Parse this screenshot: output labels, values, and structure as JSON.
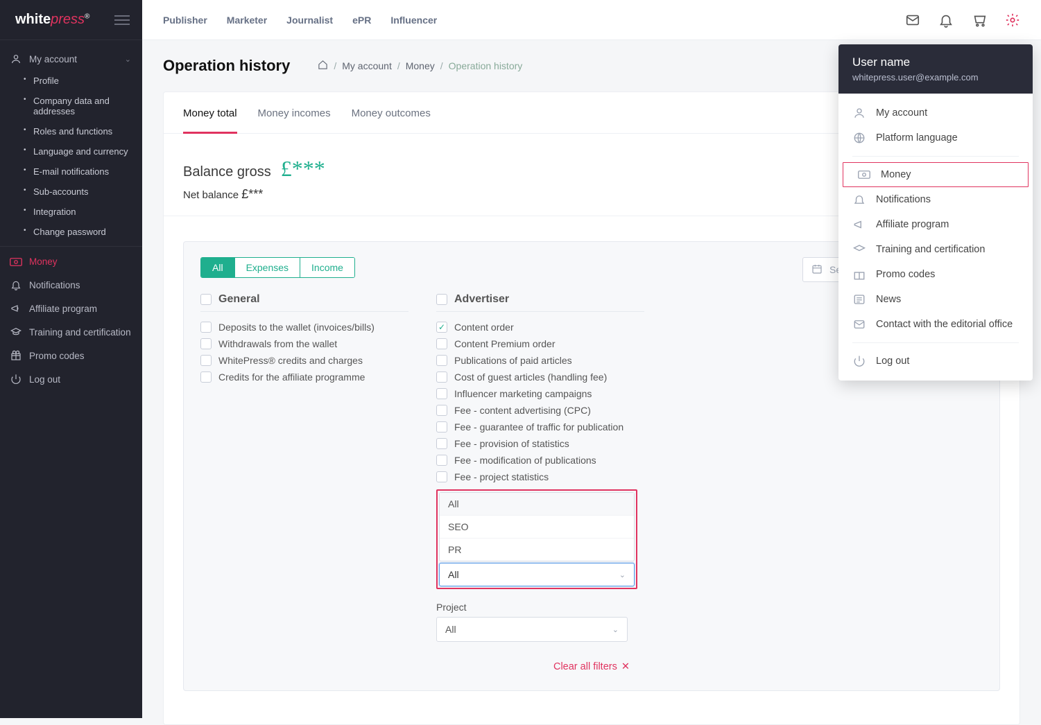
{
  "logo": {
    "part1": "white",
    "part2": "press",
    "reg": "®"
  },
  "topnav": [
    "Publisher",
    "Marketer",
    "Journalist",
    "ePR",
    "Influencer"
  ],
  "sidebar": {
    "account_label": "My account",
    "account_sub": [
      "Profile",
      "Company data and addresses",
      "Roles and functions",
      "Language and currency",
      "E-mail notifications",
      "Sub-accounts",
      "Integration",
      "Change password"
    ],
    "items": [
      {
        "label": "Money",
        "active": true,
        "icon": "money"
      },
      {
        "label": "Notifications",
        "icon": "bell"
      },
      {
        "label": "Affiliate program",
        "icon": "megaphone"
      },
      {
        "label": "Training and certification",
        "icon": "grad"
      },
      {
        "label": "Promo codes",
        "icon": "gift"
      },
      {
        "label": "Log out",
        "icon": "power"
      }
    ]
  },
  "page": {
    "title": "Operation history"
  },
  "breadcrumb": {
    "home": "⌂",
    "a": "My account",
    "b": "Money",
    "c": "Operation history"
  },
  "tabs": [
    "Money total",
    "Money incomes",
    "Money outcomes"
  ],
  "balance": {
    "gross_label": "Balance  gross",
    "gross_value": "£***",
    "net_label": "Net balance",
    "net_value": "£***"
  },
  "filter_tabs": [
    "All",
    "Expenses",
    "Income"
  ],
  "time_placeholder": "Select a time period",
  "filters": {
    "general": {
      "title": "General",
      "items": [
        "Deposits to the wallet (invoices/bills)",
        "Withdrawals from the wallet",
        "WhitePress® credits and charges",
        "Credits for the affiliate programme"
      ]
    },
    "advertiser": {
      "title": "Advertiser",
      "items": [
        {
          "label": "Content order",
          "checked": true
        },
        {
          "label": "Content Premium order"
        },
        {
          "label": "Publications of paid articles"
        },
        {
          "label": "Cost of guest articles (handling fee)"
        },
        {
          "label": "Influencer marketing campaigns"
        },
        {
          "label": "Fee - content advertising (CPC)"
        },
        {
          "label": "Fee - guarantee of traffic for publication"
        },
        {
          "label": "Fee - provision of statistics"
        },
        {
          "label": "Fee - modification of publications"
        },
        {
          "label": "Fee - project statistics"
        }
      ]
    }
  },
  "dropdown": {
    "options": [
      "All",
      "SEO",
      "PR"
    ],
    "selected": "All"
  },
  "project": {
    "label": "Project",
    "selected": "All"
  },
  "clear_label": "Clear all filters",
  "user_panel": {
    "name": "User name",
    "email": "whitepress.user@example.com",
    "group1": [
      "My account",
      "Platform language"
    ],
    "group2": [
      {
        "label": "Money",
        "hl": true,
        "icon": "money"
      },
      {
        "label": "Notifications",
        "icon": "bell"
      },
      {
        "label": "Affiliate program",
        "icon": "megaphone"
      },
      {
        "label": "Training and certification",
        "icon": "grad"
      },
      {
        "label": "Promo codes",
        "icon": "gift"
      },
      {
        "label": "News",
        "icon": "news"
      },
      {
        "label": "Contact with the editorial office",
        "icon": "mail"
      }
    ],
    "logout": "Log out"
  }
}
